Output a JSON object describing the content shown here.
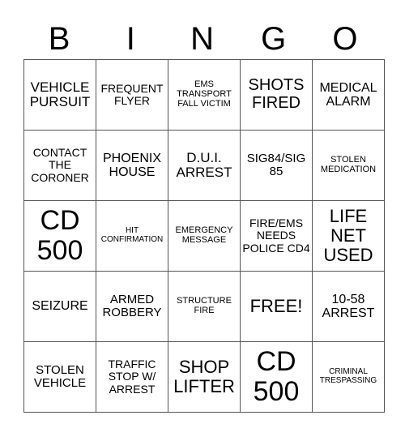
{
  "header": {
    "letters": [
      "B",
      "I",
      "N",
      "G",
      "O"
    ]
  },
  "board": {
    "rows": [
      [
        "VEHICLE PURSUIT",
        "FREQUENT FLYER",
        "EMS TRANSPORT FALL VICTIM",
        "SHOTS FIRED",
        "MEDICAL ALARM"
      ],
      [
        "CONTACT THE CORONER",
        "PHOENIX HOUSE",
        "D.U.I. ARREST",
        "SIG84/SIG 85",
        "STOLEN MEDICATION"
      ],
      [
        "CD 500",
        "HIT CONFIRMATION",
        "EMERGENCY MESSAGE",
        "FIRE/EMS NEEDS POLICE CD4",
        "LIFE NET USED"
      ],
      [
        "SEIZURE",
        "ARMED ROBBERY",
        "STRUCTURE FIRE",
        "FREE!",
        "10-58 ARREST"
      ],
      [
        "STOLEN VEHICLE",
        "TRAFFIC STOP W/ ARREST",
        "SHOP LIFTER",
        "CD 500",
        "CRIMINAL TRESPASSING"
      ]
    ]
  }
}
